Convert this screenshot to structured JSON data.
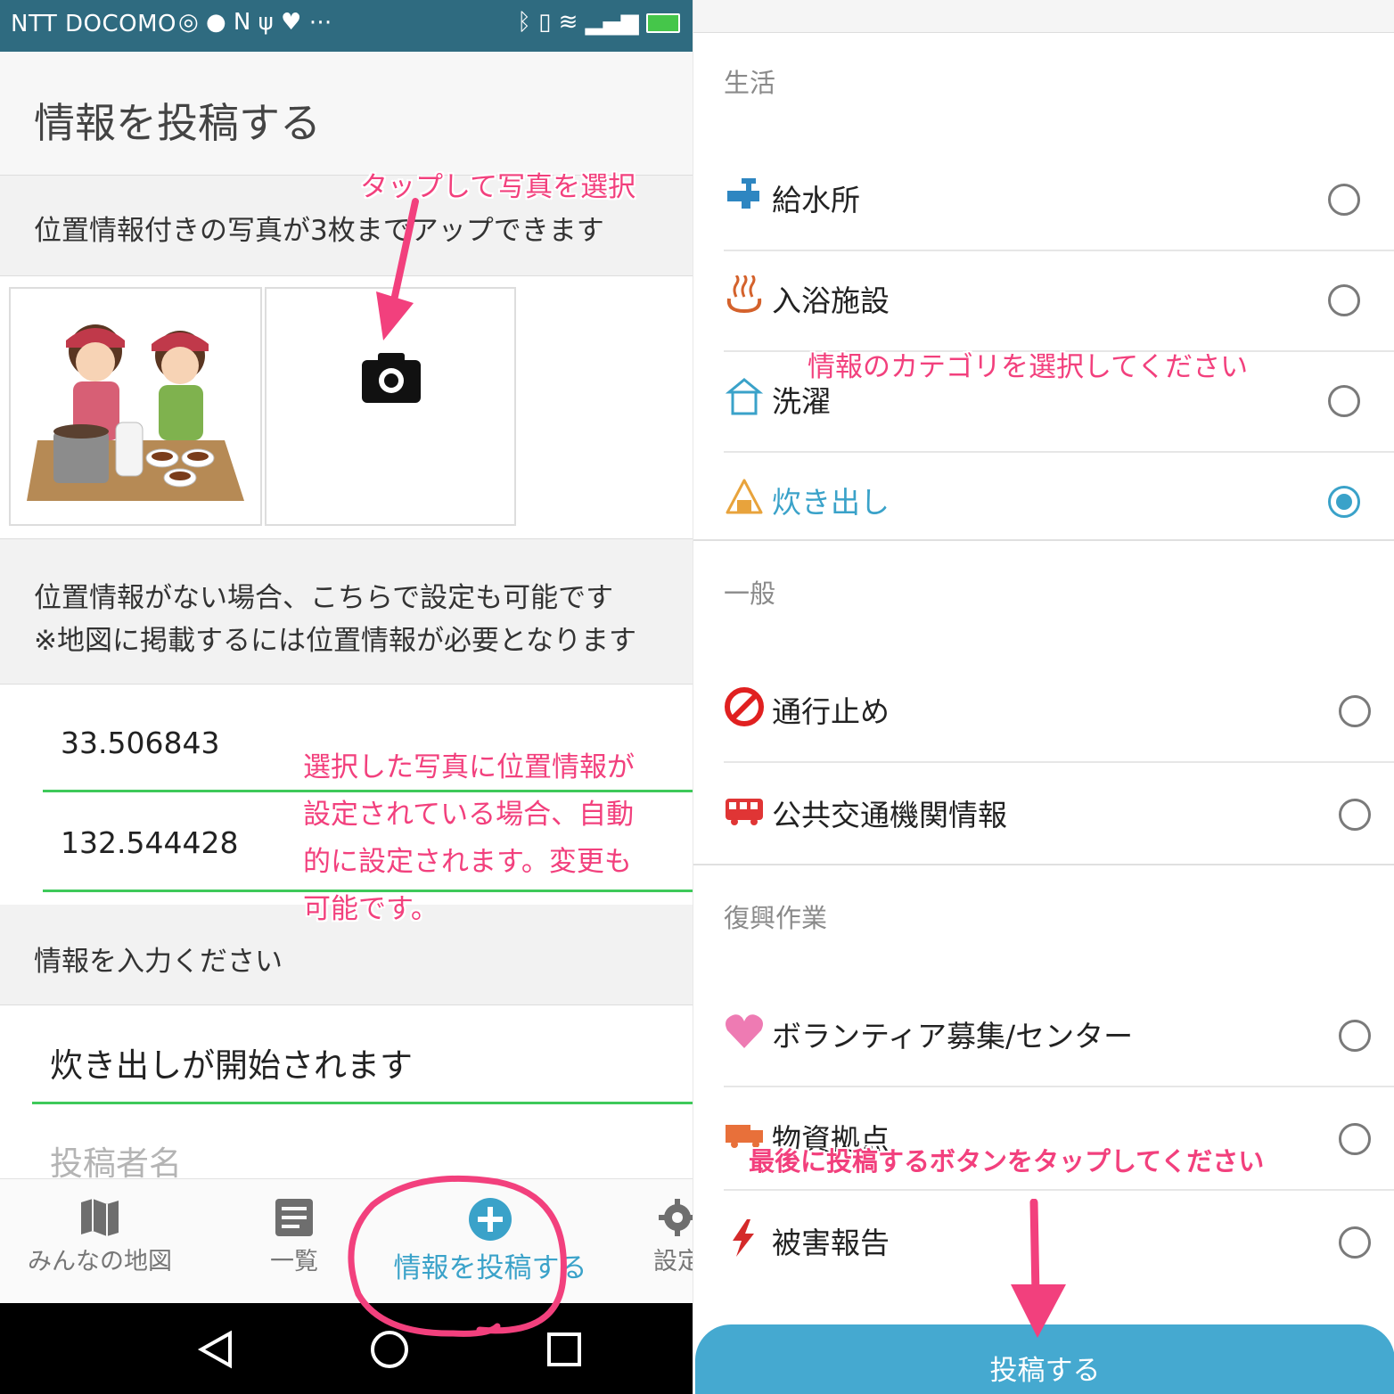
{
  "status_bar": {
    "carrier": "NTT DOCOMO",
    "extra": "⋯"
  },
  "left": {
    "title": "情報を投稿する",
    "photo_info": "位置情報付きの写真が3枚までアップできます",
    "location_note_1": "位置情報がない場合、こちらで設定も可能です",
    "location_note_2": "※地図に掲載するには位置情報が必要となります",
    "latitude": "33.506843",
    "longitude": "132.544428",
    "info_prompt": "情報を入力ください",
    "info_value": "炊き出しが開始されます",
    "author_placeholder": "投稿者名",
    "nav": [
      {
        "label": "みんなの地図",
        "icon": "map-icon"
      },
      {
        "label": "一覧",
        "icon": "list-icon"
      },
      {
        "label": "情報を投稿する",
        "icon": "add-circle-icon",
        "active": true
      },
      {
        "label": "設定",
        "icon": "gear-icon"
      }
    ]
  },
  "right": {
    "sections": [
      {
        "title": "生活",
        "items": [
          {
            "label": "給水所",
            "icon": "water-tap-icon",
            "selected": false
          },
          {
            "label": "入浴施設",
            "icon": "hot-spring-icon",
            "selected": false
          },
          {
            "label": "洗濯",
            "icon": "hanger-icon",
            "selected": false
          },
          {
            "label": "炊き出し",
            "icon": "rice-ball-icon",
            "selected": true
          }
        ]
      },
      {
        "title": "一般",
        "items": [
          {
            "label": "通行止め",
            "icon": "no-entry-icon",
            "selected": false
          },
          {
            "label": "公共交通機関情報",
            "icon": "bus-icon",
            "selected": false
          }
        ]
      },
      {
        "title": "復興作業",
        "items": [
          {
            "label": "ボランティア募集/センター",
            "icon": "heart-icon",
            "selected": false
          },
          {
            "label": "物資拠点",
            "icon": "truck-icon",
            "selected": false
          },
          {
            "label": "被害報告",
            "icon": "lightning-icon",
            "selected": false
          }
        ]
      }
    ],
    "submit_label": "投稿する"
  },
  "annotations": {
    "tap_photo": "タップして写真を選択",
    "auto_location_1": "選択した写真に位置情報が",
    "auto_location_2": "設定されている場合、自動",
    "auto_location_3": "的に設定されます。変更も",
    "auto_location_4": "可能です。",
    "select_category": "情報のカテゴリを選択してください",
    "tap_submit": "最後に投稿するボタンをタップしてください"
  },
  "colors": {
    "accent": "#3aa2c9",
    "annotation": "#f2407d",
    "input_underline": "#3ec95a",
    "status_bar": "#2f6b80"
  }
}
